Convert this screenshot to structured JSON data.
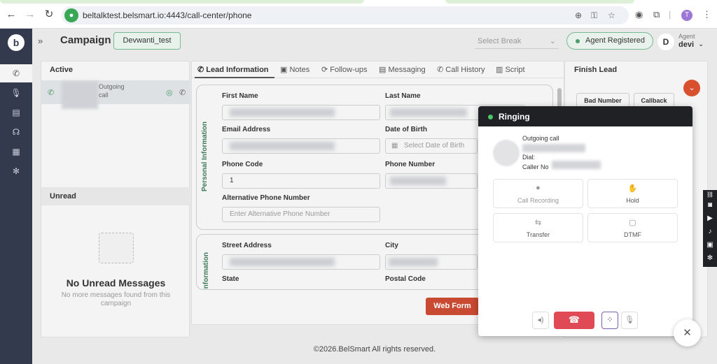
{
  "browser": {
    "url": "beltalktest.belsmart.io:4443/call-center/phone",
    "profile_initial": "T"
  },
  "sidebar": {
    "logo": "b",
    "items": [
      "phone-icon",
      "mic-icon",
      "clipboard-icon",
      "headset-icon",
      "calendar-icon",
      "gear-icon"
    ]
  },
  "header": {
    "title": "Campaign",
    "campaign_name": "Devwanti_test",
    "break_placeholder": "Select Break",
    "agent_status": "Agent Registered",
    "agent_initial": "D",
    "agent_label": "Agent",
    "agent_name": "devi"
  },
  "left": {
    "active_title": "Active",
    "call_type": "Outgoing",
    "call_sub": "call",
    "unread_title": "Unread",
    "empty_title": "No Unread Messages",
    "empty_sub": "No more messages found from this campaign"
  },
  "tabs": [
    "Lead Information",
    "Notes",
    "Follow-ups",
    "Messaging",
    "Call History",
    "Script"
  ],
  "form": {
    "section1": "Personal Information",
    "section2": "Information",
    "first_name": "First Name",
    "last_name": "Last Name",
    "email": "Email Address",
    "dob": "Date of Birth",
    "dob_placeholder": "Select Date of Birth",
    "phone_code": "Phone Code",
    "phone_code_value": "1",
    "phone_number": "Phone Number",
    "alt_phone": "Alternative Phone Number",
    "alt_phone_placeholder": "Enter Alternative Phone Number",
    "street": "Street Address",
    "city": "City",
    "state": "State",
    "postal": "Postal Code",
    "web_form": "Web Form"
  },
  "finish": {
    "title": "Finish Lead",
    "bad_number": "Bad Number",
    "callback": "Callback"
  },
  "dialer": {
    "status": "Ringing",
    "outgoing": "Outgoing call",
    "dial": "Dial:",
    "caller_no": "Caller No",
    "call_recording": "Call Recording",
    "hold": "Hold",
    "transfer": "Transfer",
    "dtmf": "DTMF"
  },
  "footer": "©2026.BelSmart All rights reserved.",
  "colors": {
    "sidebar": "#343a4d",
    "accent_green": "#4e9b6a",
    "danger": "#e04a55",
    "web_form": "#c94a32"
  }
}
